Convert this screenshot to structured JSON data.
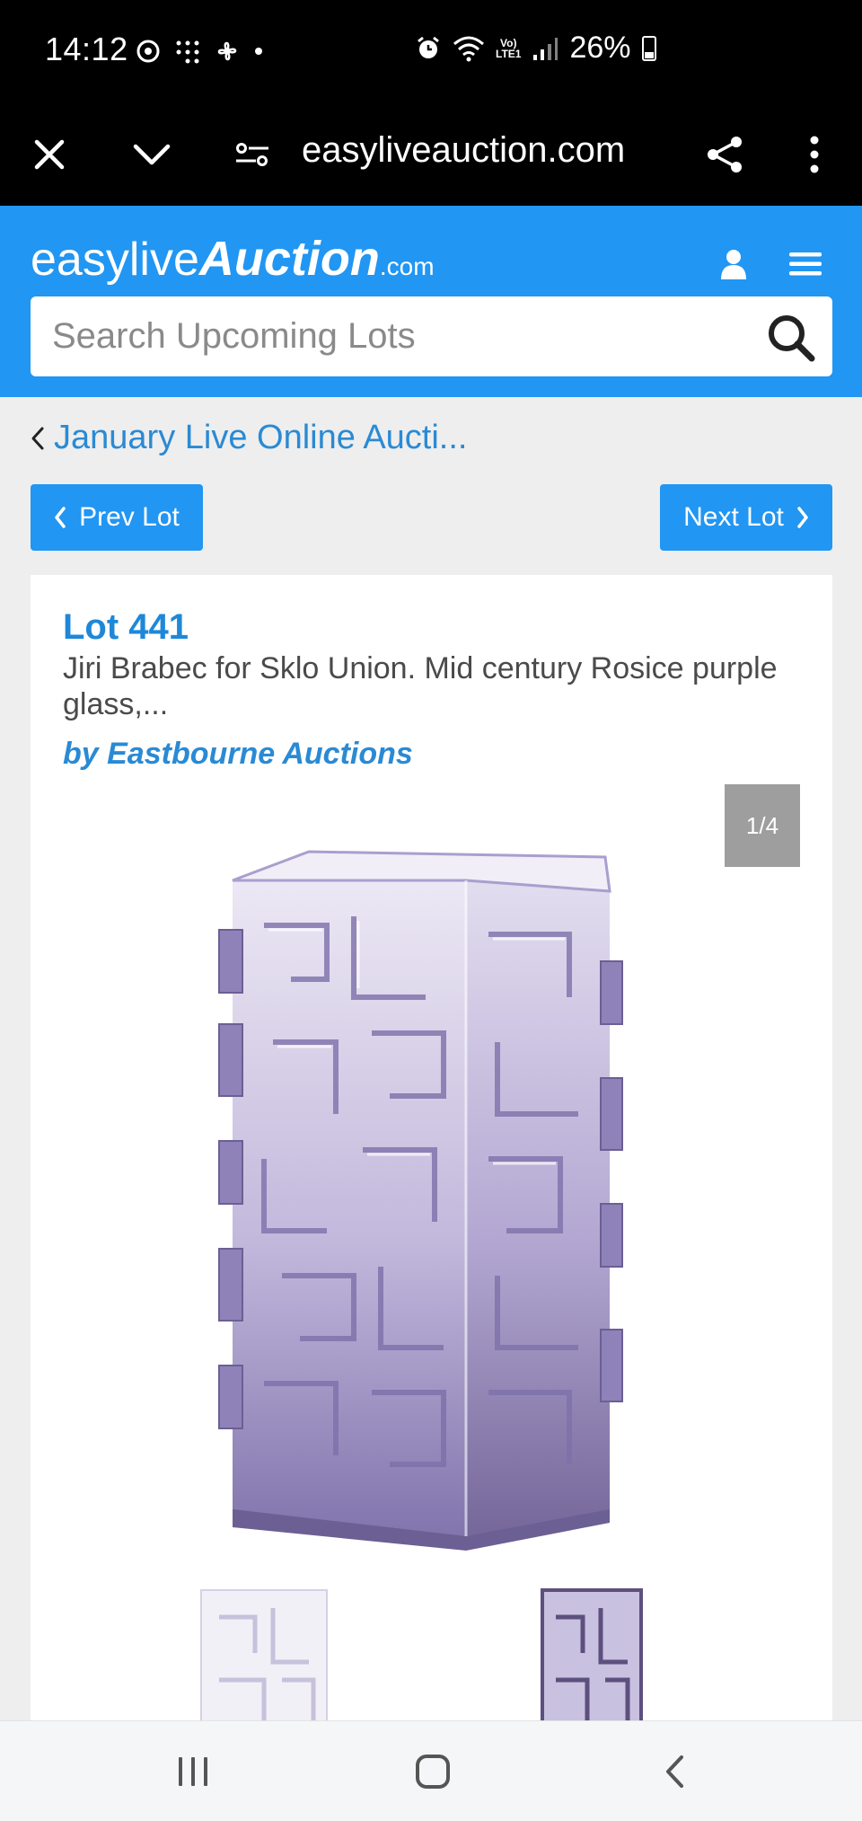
{
  "status": {
    "time": "14:12",
    "battery": "26%",
    "network": "VoLTE1"
  },
  "browser": {
    "url": "easyliveauction.com"
  },
  "header": {
    "logo_light": "easylive",
    "logo_bold": "Auction",
    "logo_suffix": ".com",
    "search_placeholder": "Search Upcoming Lots"
  },
  "breadcrumb": {
    "label": "January Live Online Aucti..."
  },
  "nav": {
    "prev_label": "Prev Lot",
    "next_label": "Next Lot"
  },
  "lot": {
    "number": "Lot 441",
    "description": "Jiri Brabec for Sklo Union. Mid century Rosice purple glass,...",
    "auctioneer": "by Eastbourne Auctions",
    "image_counter": "1/4"
  },
  "colors": {
    "brand_blue": "#2196f3",
    "link_blue": "#2a8ad4",
    "glass_purple": "#8c7fb8"
  },
  "icons": {
    "close": "close-icon",
    "collapse": "chevron-down-icon",
    "site_settings": "tune-icon",
    "share": "share-icon",
    "more": "more-vertical-icon",
    "account": "user-icon",
    "menu": "hamburger-icon",
    "search": "search-icon",
    "back": "chevron-left-icon"
  }
}
